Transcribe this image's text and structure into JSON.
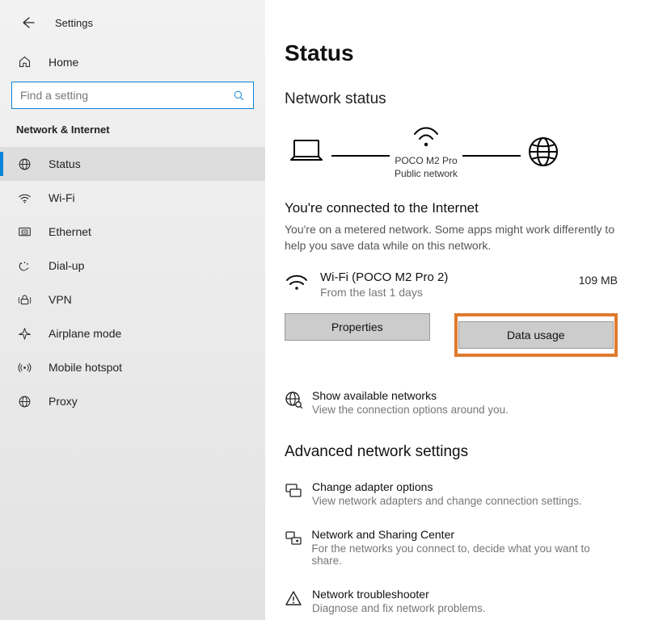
{
  "header": {
    "app_title": "Settings"
  },
  "home": {
    "label": "Home"
  },
  "search": {
    "placeholder": "Find a setting"
  },
  "section_title": "Network & Internet",
  "nav": {
    "items": [
      {
        "label": "Status"
      },
      {
        "label": "Wi-Fi"
      },
      {
        "label": "Ethernet"
      },
      {
        "label": "Dial-up"
      },
      {
        "label": "VPN"
      },
      {
        "label": "Airplane mode"
      },
      {
        "label": "Mobile hotspot"
      },
      {
        "label": "Proxy"
      }
    ]
  },
  "page": {
    "title": "Status",
    "subtitle": "Network status",
    "diagram": {
      "conn_name": "POCO M2 Pro",
      "conn_type": "Public network"
    },
    "connected": {
      "title": "You're connected to the Internet",
      "note": "You're on a metered network. Some apps might work differently to help you save data while on this network.",
      "wifi_name": "Wi-Fi (POCO M2 Pro 2)",
      "wifi_sub": "From the last 1 days",
      "amount": "109 MB",
      "btn_properties": "Properties",
      "btn_data_usage": "Data usage"
    },
    "available": {
      "title": "Show available networks",
      "sub": "View the connection options around you."
    },
    "advanced": {
      "title": "Advanced network settings",
      "items": [
        {
          "title": "Change adapter options",
          "sub": "View network adapters and change connection settings."
        },
        {
          "title": "Network and Sharing Center",
          "sub": "For the networks you connect to, decide what you want to share."
        },
        {
          "title": "Network troubleshooter",
          "sub": "Diagnose and fix network problems."
        }
      ]
    }
  }
}
